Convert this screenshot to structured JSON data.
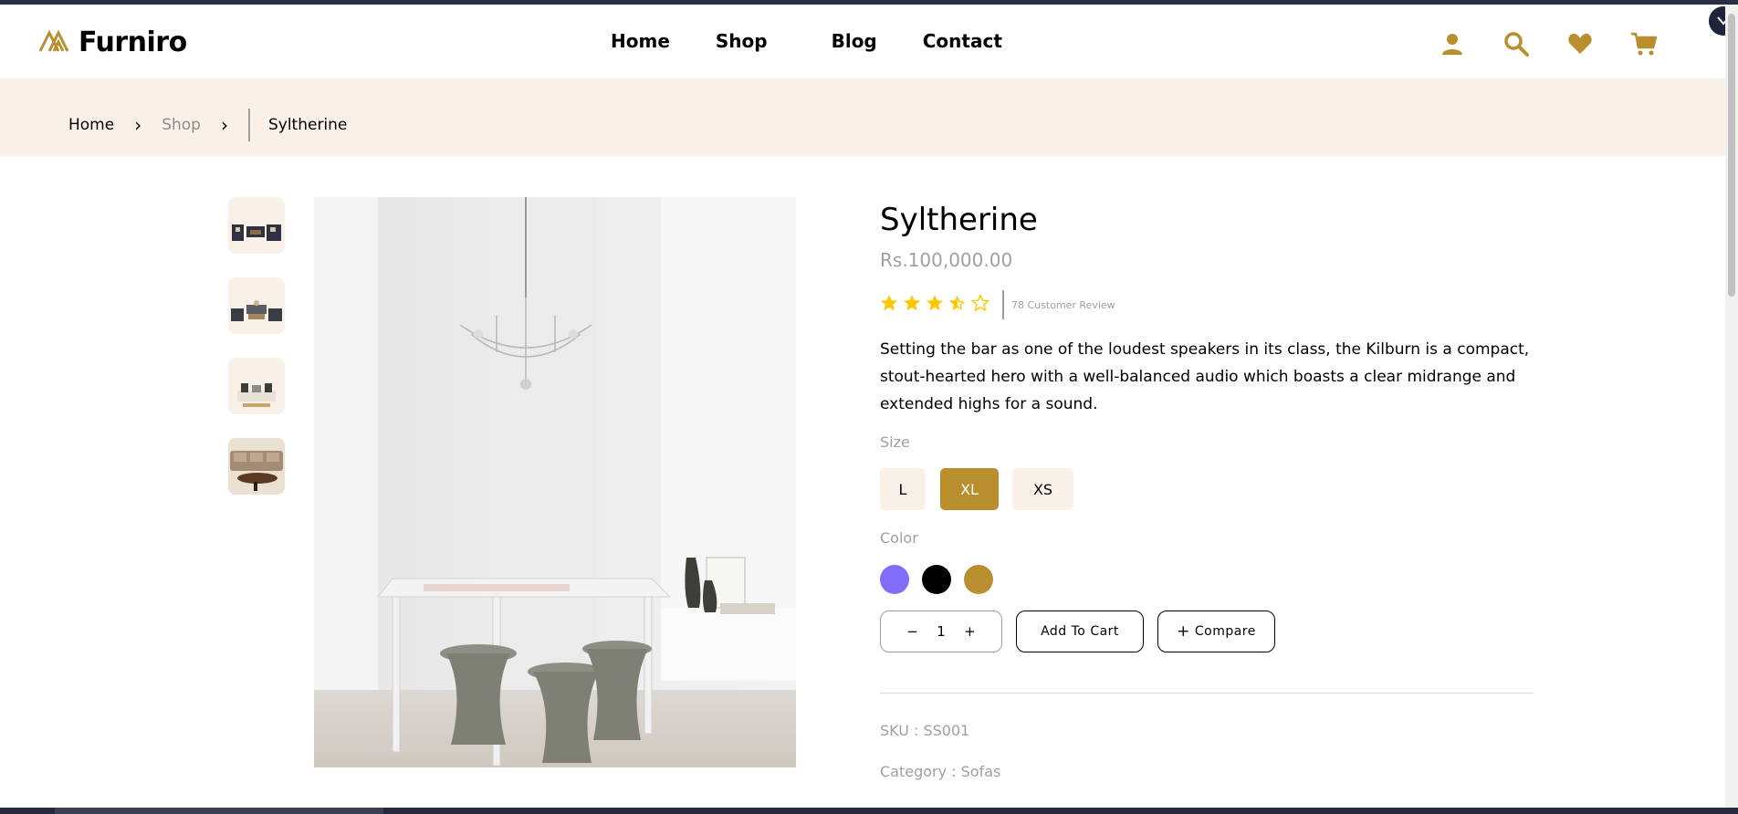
{
  "brand": {
    "name": "Furniro",
    "accent": "#b88e2f",
    "cream": "#f9f1e7"
  },
  "nav": {
    "home": "Home",
    "shop": "Shop",
    "blog": "Blog",
    "contact": "Contact"
  },
  "header_icons": [
    "user-icon",
    "search-icon",
    "heart-icon",
    "cart-icon"
  ],
  "breadcrumb": {
    "home": "Home",
    "shop": "Shop",
    "current": "Syltherine"
  },
  "product": {
    "title": "Syltherine",
    "price": "Rs.100,000.00",
    "rating": 3.5,
    "rating_max": 5,
    "reviews": "78 Customer Review",
    "description": "Setting the bar as one of the loudest speakers in its class, the Kilburn is a compact, stout-hearted hero with a well-balanced audio which boasts a clear midrange and extended highs for a sound.",
    "size_label": "Size",
    "sizes": [
      "L",
      "XL",
      "XS"
    ],
    "selected_size": "XL",
    "color_label": "Color",
    "colors": [
      "#816dfa",
      "#000000",
      "#b88e2f"
    ],
    "quantity": "1",
    "qty_minus": "−",
    "qty_plus": "+",
    "add_to_cart": "Add To Cart",
    "compare_plus": "+",
    "compare": "Compare",
    "sku": "SKU : SS001",
    "category": "Category : Sofas"
  }
}
